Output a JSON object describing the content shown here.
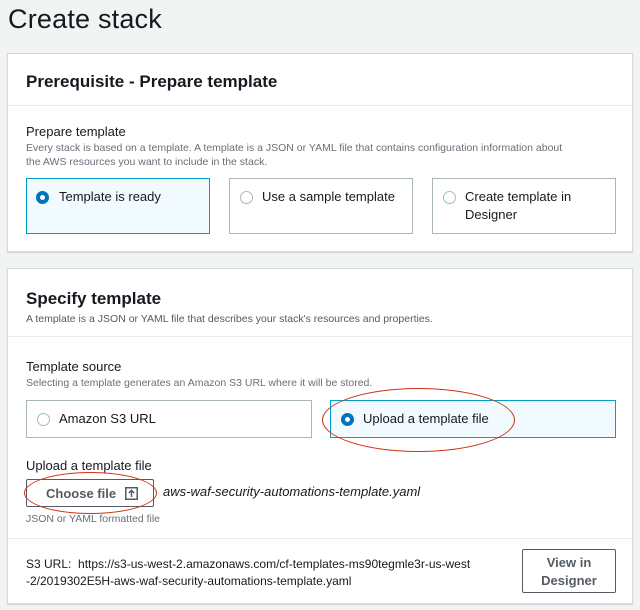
{
  "page": {
    "title": "Create stack"
  },
  "prerequisite": {
    "title": "Prerequisite - Prepare template",
    "field_label": "Prepare template",
    "field_desc_line1": "Every stack is based on a template. A template is a JSON or YAML file that contains configuration information about",
    "field_desc_line2": "the AWS resources you want to include in the stack.",
    "options": [
      {
        "label": "Template is ready",
        "selected": true
      },
      {
        "label": "Use a sample template",
        "selected": false
      },
      {
        "label_line1": "Create template in",
        "label_line2": "Designer",
        "selected": false
      }
    ]
  },
  "specify": {
    "title": "Specify template",
    "desc": "A template is a JSON or YAML file that describes your stack's resources and properties.",
    "source_label": "Template source",
    "source_desc": "Selecting a template generates an Amazon S3 URL where it will be stored.",
    "source_options": [
      {
        "label": "Amazon S3 URL",
        "selected": false
      },
      {
        "label": "Upload a template file",
        "selected": true
      }
    ],
    "upload_label": "Upload a template file",
    "choose_file_label": "Choose file",
    "file_name": "aws-waf-security-automations-template.yaml",
    "file_hint": "JSON or YAML formatted file",
    "s3_url_prefix": "S3 URL:",
    "s3_url_line1": "https://s3-us-west-2.amazonaws.com/cf-templates-ms90tegmle3r-us-west",
    "s3_url_line2": "-2/2019302E5H-aws-waf-security-automations-template.yaml",
    "view_designer_line1": "View in",
    "view_designer_line2": "Designer"
  },
  "colors": {
    "accent": "#0073bb",
    "selected_border": "#00a1c9",
    "annotation": "#d13212"
  }
}
